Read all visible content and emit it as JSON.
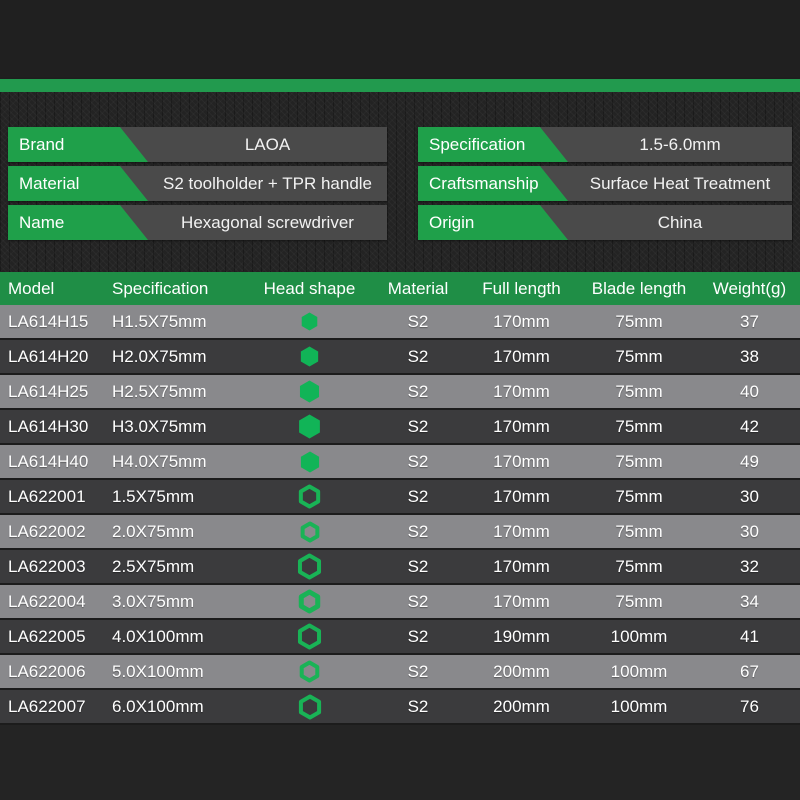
{
  "theme": {
    "green_accent": "#1FA04A",
    "header_green": "#1F8E46",
    "divider_green": "#229A4E",
    "glyph_green": "#11B457",
    "row_light": "#89898C",
    "row_dark": "#3B3B3D",
    "page_background": "#1e1e1e",
    "info_value_background": "#4a4a4a"
  },
  "info_left": [
    {
      "label": "Brand",
      "value": "LAOA"
    },
    {
      "label": "Material",
      "value": "S2 toolholder + TPR handle"
    },
    {
      "label": "Name",
      "value": "Hexagonal screwdriver"
    }
  ],
  "info_right": [
    {
      "label": "Specification",
      "value": "1.5-6.0mm"
    },
    {
      "label": "Craftsmanship",
      "value": "Surface Heat Treatment"
    },
    {
      "label": "Origin",
      "value": "China"
    }
  ],
  "table": {
    "headers": [
      "Model",
      "Specification",
      "Head shape",
      "Material",
      "Full length",
      "Blade length",
      "Weight(g)"
    ],
    "rows": [
      {
        "model": "LA614H15",
        "specification": "H1.5X75mm",
        "head_shape": {
          "icon": "solid-hexagon-icon",
          "size": 19
        },
        "material": "S2",
        "full_length": "170mm",
        "blade_length": "75mm",
        "weight": "37"
      },
      {
        "model": "LA614H20",
        "specification": "H2.0X75mm",
        "head_shape": {
          "icon": "solid-hexagon-icon",
          "size": 21
        },
        "material": "S2",
        "full_length": "170mm",
        "blade_length": "75mm",
        "weight": "38"
      },
      {
        "model": "LA614H25",
        "specification": "H2.5X75mm",
        "head_shape": {
          "icon": "solid-hexagon-icon",
          "size": 23
        },
        "material": "S2",
        "full_length": "170mm",
        "blade_length": "75mm",
        "weight": "40"
      },
      {
        "model": "LA614H30",
        "specification": "H3.0X75mm",
        "head_shape": {
          "icon": "solid-hexagon-icon",
          "size": 25
        },
        "material": "S2",
        "full_length": "170mm",
        "blade_length": "75mm",
        "weight": "42"
      },
      {
        "model": "LA614H40",
        "specification": "H4.0X75mm",
        "head_shape": {
          "icon": "solid-hexagon-icon",
          "size": 22
        },
        "material": "S2",
        "full_length": "170mm",
        "blade_length": "75mm",
        "weight": "49"
      },
      {
        "model": "LA622001",
        "specification": "1.5X75mm",
        "head_shape": {
          "icon": "hexagon-ring-icon",
          "size": 25,
          "stroke": 4
        },
        "material": "S2",
        "full_length": "170mm",
        "blade_length": "75mm",
        "weight": "30"
      },
      {
        "model": "LA622002",
        "specification": "2.0X75mm",
        "head_shape": {
          "icon": "hexagon-ring-icon",
          "size": 22,
          "stroke": 4
        },
        "material": "S2",
        "full_length": "170mm",
        "blade_length": "75mm",
        "weight": "30"
      },
      {
        "model": "LA622003",
        "specification": "2.5X75mm",
        "head_shape": {
          "icon": "hexagon-ring-icon",
          "size": 27,
          "stroke": 4
        },
        "material": "S2",
        "full_length": "170mm",
        "blade_length": "75mm",
        "weight": "32"
      },
      {
        "model": "LA622004",
        "specification": "3.0X75mm",
        "head_shape": {
          "icon": "hexagon-ring-icon",
          "size": 25,
          "stroke": 5
        },
        "material": "S2",
        "full_length": "170mm",
        "blade_length": "75mm",
        "weight": "34"
      },
      {
        "model": "LA622005",
        "specification": "4.0X100mm",
        "head_shape": {
          "icon": "hexagon-ring-icon",
          "size": 27,
          "stroke": 4
        },
        "material": "S2",
        "full_length": "190mm",
        "blade_length": "100mm",
        "weight": "41"
      },
      {
        "model": "LA622006",
        "specification": "5.0X100mm",
        "head_shape": {
          "icon": "hexagon-ring-icon",
          "size": 23,
          "stroke": 4
        },
        "material": "S2",
        "full_length": "200mm",
        "blade_length": "100mm",
        "weight": "67"
      },
      {
        "model": "LA622007",
        "specification": "6.0X100mm",
        "head_shape": {
          "icon": "hexagon-ring-icon",
          "size": 26,
          "stroke": 4
        },
        "material": "S2",
        "full_length": "200mm",
        "blade_length": "100mm",
        "weight": "76"
      }
    ]
  }
}
